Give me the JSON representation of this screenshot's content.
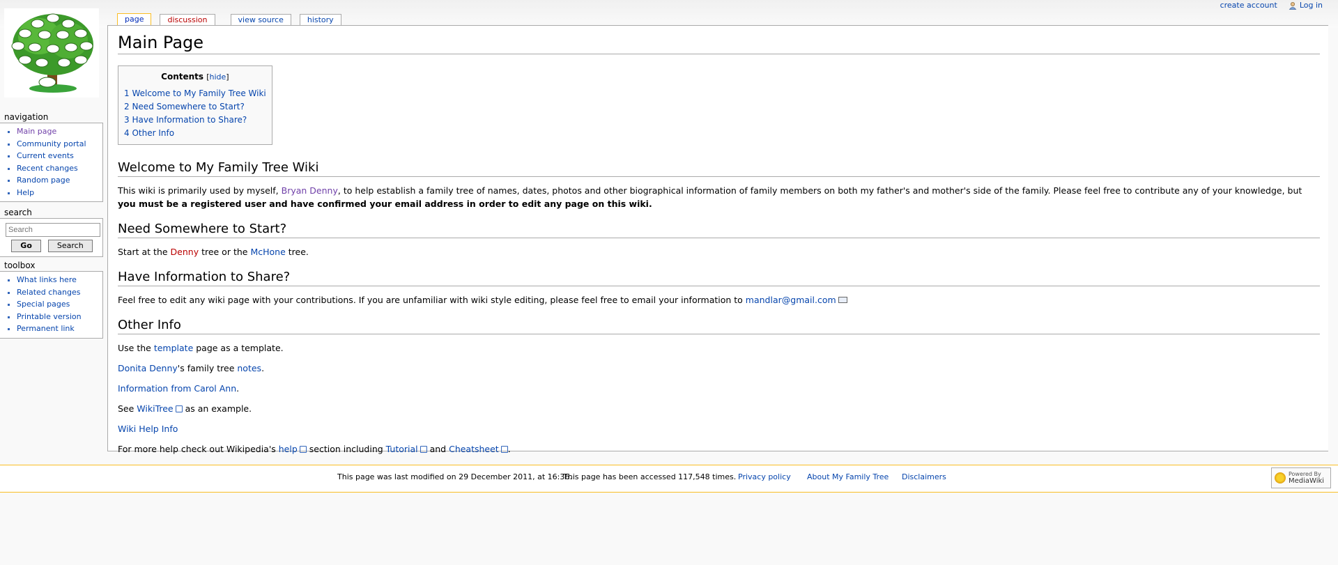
{
  "personal_tools": {
    "create_account": "create account",
    "log_in": "Log in"
  },
  "tabs": [
    {
      "label": "page"
    },
    {
      "label": "discussion"
    },
    {
      "label": "view source"
    },
    {
      "label": "history"
    }
  ],
  "navigation": {
    "title": "navigation",
    "items": [
      {
        "label": "Main page"
      },
      {
        "label": "Community portal"
      },
      {
        "label": "Current events"
      },
      {
        "label": "Recent changes"
      },
      {
        "label": "Random page"
      },
      {
        "label": "Help"
      }
    ]
  },
  "search": {
    "title": "search",
    "placeholder": "Search",
    "go_label": "Go",
    "search_label": "Search"
  },
  "toolbox": {
    "title": "toolbox",
    "items": [
      {
        "label": "What links here"
      },
      {
        "label": "Related changes"
      },
      {
        "label": "Special pages"
      },
      {
        "label": "Printable version"
      },
      {
        "label": "Permanent link"
      }
    ]
  },
  "page": {
    "title": "Main Page",
    "toc": {
      "title": "Contents",
      "hide": "hide",
      "items": [
        {
          "label": "1 Welcome to My Family Tree Wiki"
        },
        {
          "label": "2 Need Somewhere to Start?"
        },
        {
          "label": "3 Have Information to Share?"
        },
        {
          "label": "4 Other Info"
        }
      ]
    },
    "section1": {
      "heading": "Welcome to My Family Tree Wiki",
      "p_a": "This wiki is primarily used by myself, ",
      "link": "Bryan Denny",
      "p_b": ", to help establish a family tree of names, dates, photos and other biographical information of family members on both my father's and mother's side of the family. Please feel free to contribute any of your knowledge, but ",
      "bold": "you must be a registered user and have confirmed your email address in order to edit any page on this wiki."
    },
    "section2": {
      "heading": "Need Somewhere to Start?",
      "p_a": "Start at the ",
      "link1": "Denny",
      "p_b": " tree or the ",
      "link2": "McHone",
      "p_c": " tree."
    },
    "section3": {
      "heading": "Have Information to Share?",
      "p_a": "Feel free to edit any wiki page with your contributions. If you are unfamiliar with wiki style editing, please feel free to email your information to ",
      "email": "mandlar@gmail.com"
    },
    "section4": {
      "heading": "Other Info",
      "l1_a": "Use the ",
      "l1_link": "template",
      "l1_b": " page as a template.",
      "l2_link1": "Donita Denny",
      "l2_b": "'s family tree ",
      "l2_link2": "notes",
      "l2_c": ".",
      "l3_link": "Information from Carol Ann",
      "l3_b": ".",
      "l4_a": "See ",
      "l4_link": "WikiTree",
      "l4_b": " as an example.",
      "l5_link": "Wiki Help Info",
      "l6_a": "For more help check out Wikipedia's ",
      "l6_link1": "help",
      "l6_b": " section including ",
      "l6_link2": "Tutorial",
      "l6_c": " and ",
      "l6_link3": "Cheatsheet",
      "l6_d": "."
    }
  },
  "footer": {
    "lastmod": "This page was last modified on 29 December 2011, at 16:36.",
    "views": "This page has been accessed 117,548 times.",
    "privacy": "Privacy policy",
    "about": "About My Family Tree",
    "disclaimers": "Disclaimers",
    "powered_line1": "Powered By",
    "powered_line2": "MediaWiki"
  }
}
